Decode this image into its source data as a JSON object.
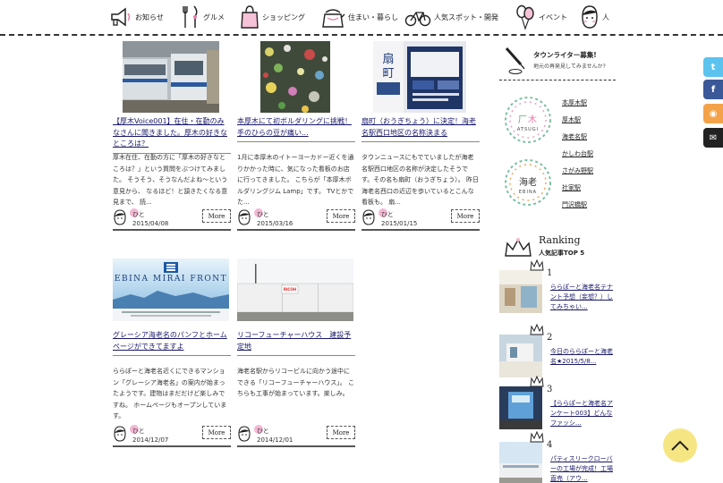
{
  "nav": {
    "items": [
      {
        "label": "お知らせ",
        "icon": "megaphone-icon"
      },
      {
        "label": "グルメ",
        "icon": "fork-knife-icon"
      },
      {
        "label": "ショッピング",
        "icon": "shopping-bag-icon"
      },
      {
        "label": "住まい・暮らし",
        "icon": "kettle-icon"
      },
      {
        "label": "人気スポット・開発",
        "icon": "bicycle-icon"
      },
      {
        "label": "イベント",
        "icon": "balloons-icon"
      },
      {
        "label": "人",
        "icon": "person-face-icon"
      }
    ]
  },
  "articles": [
    {
      "title": "【厚木Voice001】在住・在勤のみなさんに聞きました。厚木の好きなところは？",
      "body": "厚木在住、在勤の方に「厚木の好きなところは？」という質問をぶつけてみました。 そうそう、そうなんだよね〜という意見から、 なるほど！と頷きたくなる意見まで、 読...",
      "author": "ひと",
      "date": "2015/04/08",
      "more": "More",
      "image": "train-photo"
    },
    {
      "title": "本厚木にて初ボルダリングに挑戦！手のひらの豆が痛い...",
      "body": "1月に本厚木のイトーヨーカドー近くを通りかかった時に、気になった看板のお店に行ってきました。 こちらが「本厚木ボルダリングジム Lamp」です。 TVとかでた...",
      "author": "ひと",
      "date": "2015/03/16",
      "more": "More",
      "image": "climbing-wall-photo"
    },
    {
      "title": "扇町（おうぎちょう）に決定！海老名駅西口地区の名称決まる",
      "body": "タウンニュースにもでていましたが海老名駅西口地区の名称が決定したそうです。その名も扇町（おうぎちょう）。 昨日海老名西口の近辺を歩いているとこんな看板も。 扇...",
      "author": "ひと",
      "date": "2015/01/15",
      "more": "More",
      "image": "sign-photo"
    },
    {
      "title": "グレーシア海老名のパンフとホームページができてますよ",
      "body": "ららぽーと海老名近くにできるマンション「グレーシア海老名」の案内が始まったようです。建物はまだだけど楽しみですね。 ホームページもオープンしています。",
      "author": "ひと",
      "date": "2014/12/07",
      "more": "More",
      "image": "ebina-mirai-front-banner",
      "banner_text": "EBINA MIRAI FRONT"
    },
    {
      "title": "リコーフューチャーハウス　建設予定地",
      "body": "海老名駅からリコービルに向かう途中にできる「リコーフューチャーハウス」。 こちらも工事が始まっています。楽しみ。",
      "author": "ひと",
      "date": "2014/12/01",
      "more": "More",
      "image": "construction-site-photo",
      "sign_text": "RICOH"
    }
  ],
  "sidebar": {
    "writer": {
      "title": "タウンライター募集!",
      "subtitle": "地元の再発見してみませんか?"
    },
    "atsugi_badge": "ATSUGI",
    "ebina_badge": "EBINA",
    "stations": [
      "本厚木駅",
      "厚木駅",
      "海老名駅",
      "かしわ台駅",
      "さがみ野駅",
      "社家駅",
      "門沢橋駅"
    ],
    "ranking": {
      "title": "Ranking",
      "subtitle": "人気記事TOP 5",
      "items": [
        {
          "rank": "1",
          "text": "ららぽーと海老名テナント予想（妄想？）してみちゃい..."
        },
        {
          "rank": "2",
          "text": "今日のららぽーと海老名★2015/5/8..."
        },
        {
          "rank": "3",
          "text": "【ららぽーと海老名アンケート003】どんなファッシ..."
        },
        {
          "rank": "4",
          "text": "パティスリークローバーの工場が完成！工場直売（アウ..."
        }
      ]
    }
  },
  "social": [
    {
      "name": "twitter",
      "glyph": "t",
      "color": "#5bc3ee"
    },
    {
      "name": "facebook",
      "glyph": "f",
      "color": "#3b5998"
    },
    {
      "name": "rss",
      "glyph": "◉",
      "color": "#f4a249"
    },
    {
      "name": "mail",
      "glyph": "✉",
      "color": "#222222"
    }
  ],
  "colors": {
    "accent_pink": "#f3b7d3",
    "to_top": "#f6e683"
  }
}
